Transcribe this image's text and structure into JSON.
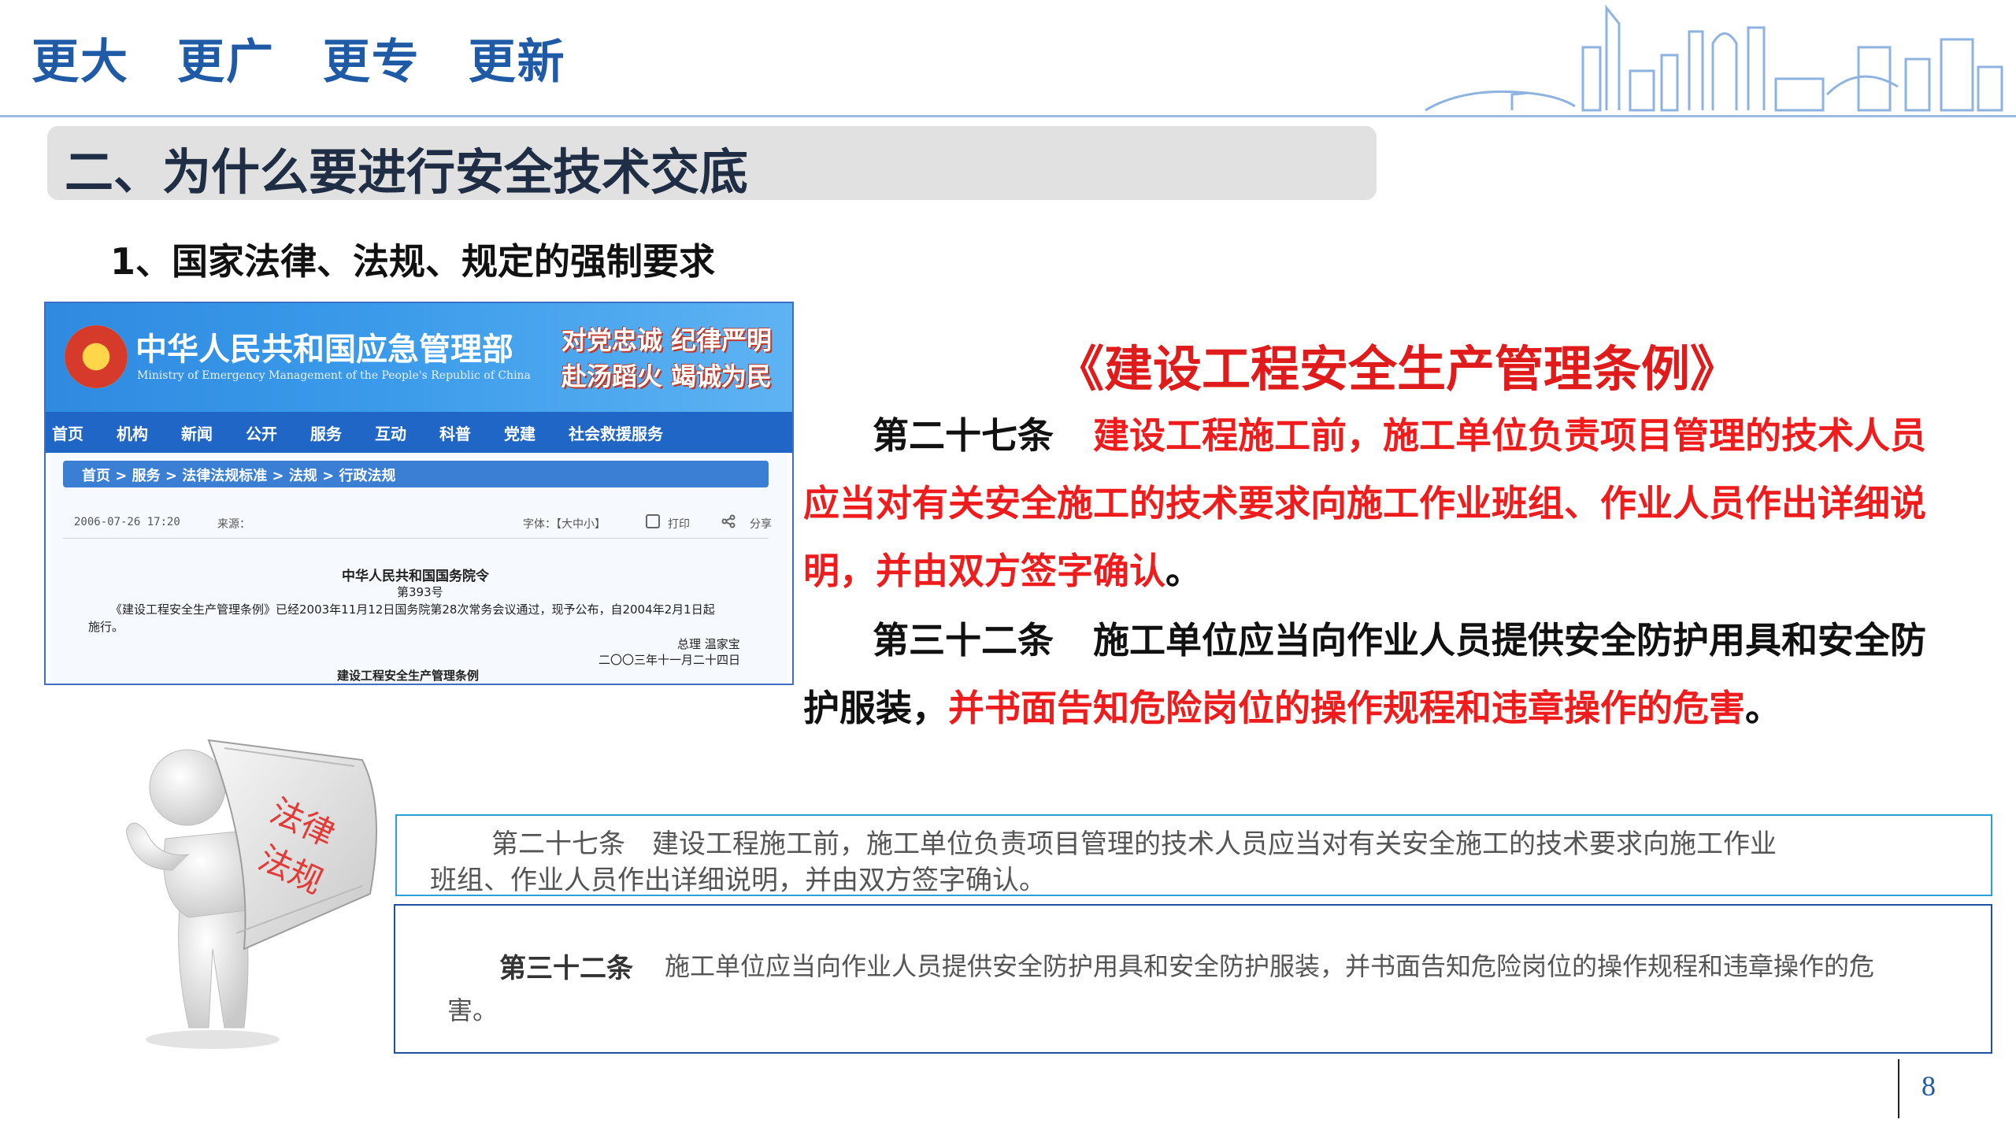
{
  "header": {
    "slogans": [
      "更大",
      "更广",
      "更专",
      "更新"
    ]
  },
  "section": {
    "title": "二、为什么要进行安全技术交底"
  },
  "subheading": "1、国家法律、法规、规定的强制要求",
  "website": {
    "cn_title": "中华人民共和国应急管理部",
    "en_title": "Ministry of Emergency Management of the People's Republic of China",
    "motto_line1": "对党忠诚 纪律严明",
    "motto_line2": "赴汤蹈火 竭诚为民",
    "nav": [
      "首页",
      "机构",
      "新闻",
      "公开",
      "服务",
      "互动",
      "科普",
      "党建",
      "社会救援服务"
    ],
    "breadcrumb": "首页 > 服务 > 法律法规标准 > 法规 > 行政法规",
    "date": "2006-07-26 17:20",
    "source_label": "来源：",
    "font_size_label": "字体：【大中小】",
    "print_label": "打印",
    "share_label": "分享",
    "doc_org": "中华人民共和国国务院令",
    "doc_no": "第393号",
    "doc_line1": "《建设工程安全生产管理条例》已经2003年11月12日国务院第28次常务会议通过，现予公布，自2004年2月1日起",
    "doc_line2": "施行。",
    "doc_sign": "总理  温家宝",
    "doc_date": "二〇〇三年十一月二十四日",
    "doc_title": "建设工程安全生产管理条例"
  },
  "figure": {
    "book_text_1": "法律",
    "book_text_2": "法规"
  },
  "law": {
    "title": "《建设工程安全生产管理条例》",
    "art27_label": "第二十七条",
    "art27_text": "建设工程施工前，施工单位负责项目管理的技术人员应当对有关安全施工的技术要求向施工作业班组、作业人员作出详细说明，并由双方签字确认",
    "art27_end": "。",
    "art32_label": "第三十二条",
    "art32_text_black": "施工单位应当向作业人员提供安全防护用具和安全防护服装，",
    "art32_text_red": "并书面告知危险岗位的操作规程和违章操作的危害",
    "art32_end": "。"
  },
  "box1": {
    "line1": "第二十七条　建设工程施工前，施工单位负责项目管理的技术人员应当对有关安全施工的技术要求向施工作业",
    "line2": "班组、作业人员作出详细说明，并由双方签字确认。"
  },
  "box2": {
    "label": "第三十二条",
    "line1": "施工单位应当向作业人员提供安全防护用具和安全防护服装，并书面告知危险岗位的操作规程和违章操作的危",
    "line2": "害。"
  },
  "page_number": "8",
  "colors": {
    "brand_blue": "#1f5aa6",
    "highlight_red": "#ee1c1c",
    "section_bar": "#e1e1e1"
  }
}
